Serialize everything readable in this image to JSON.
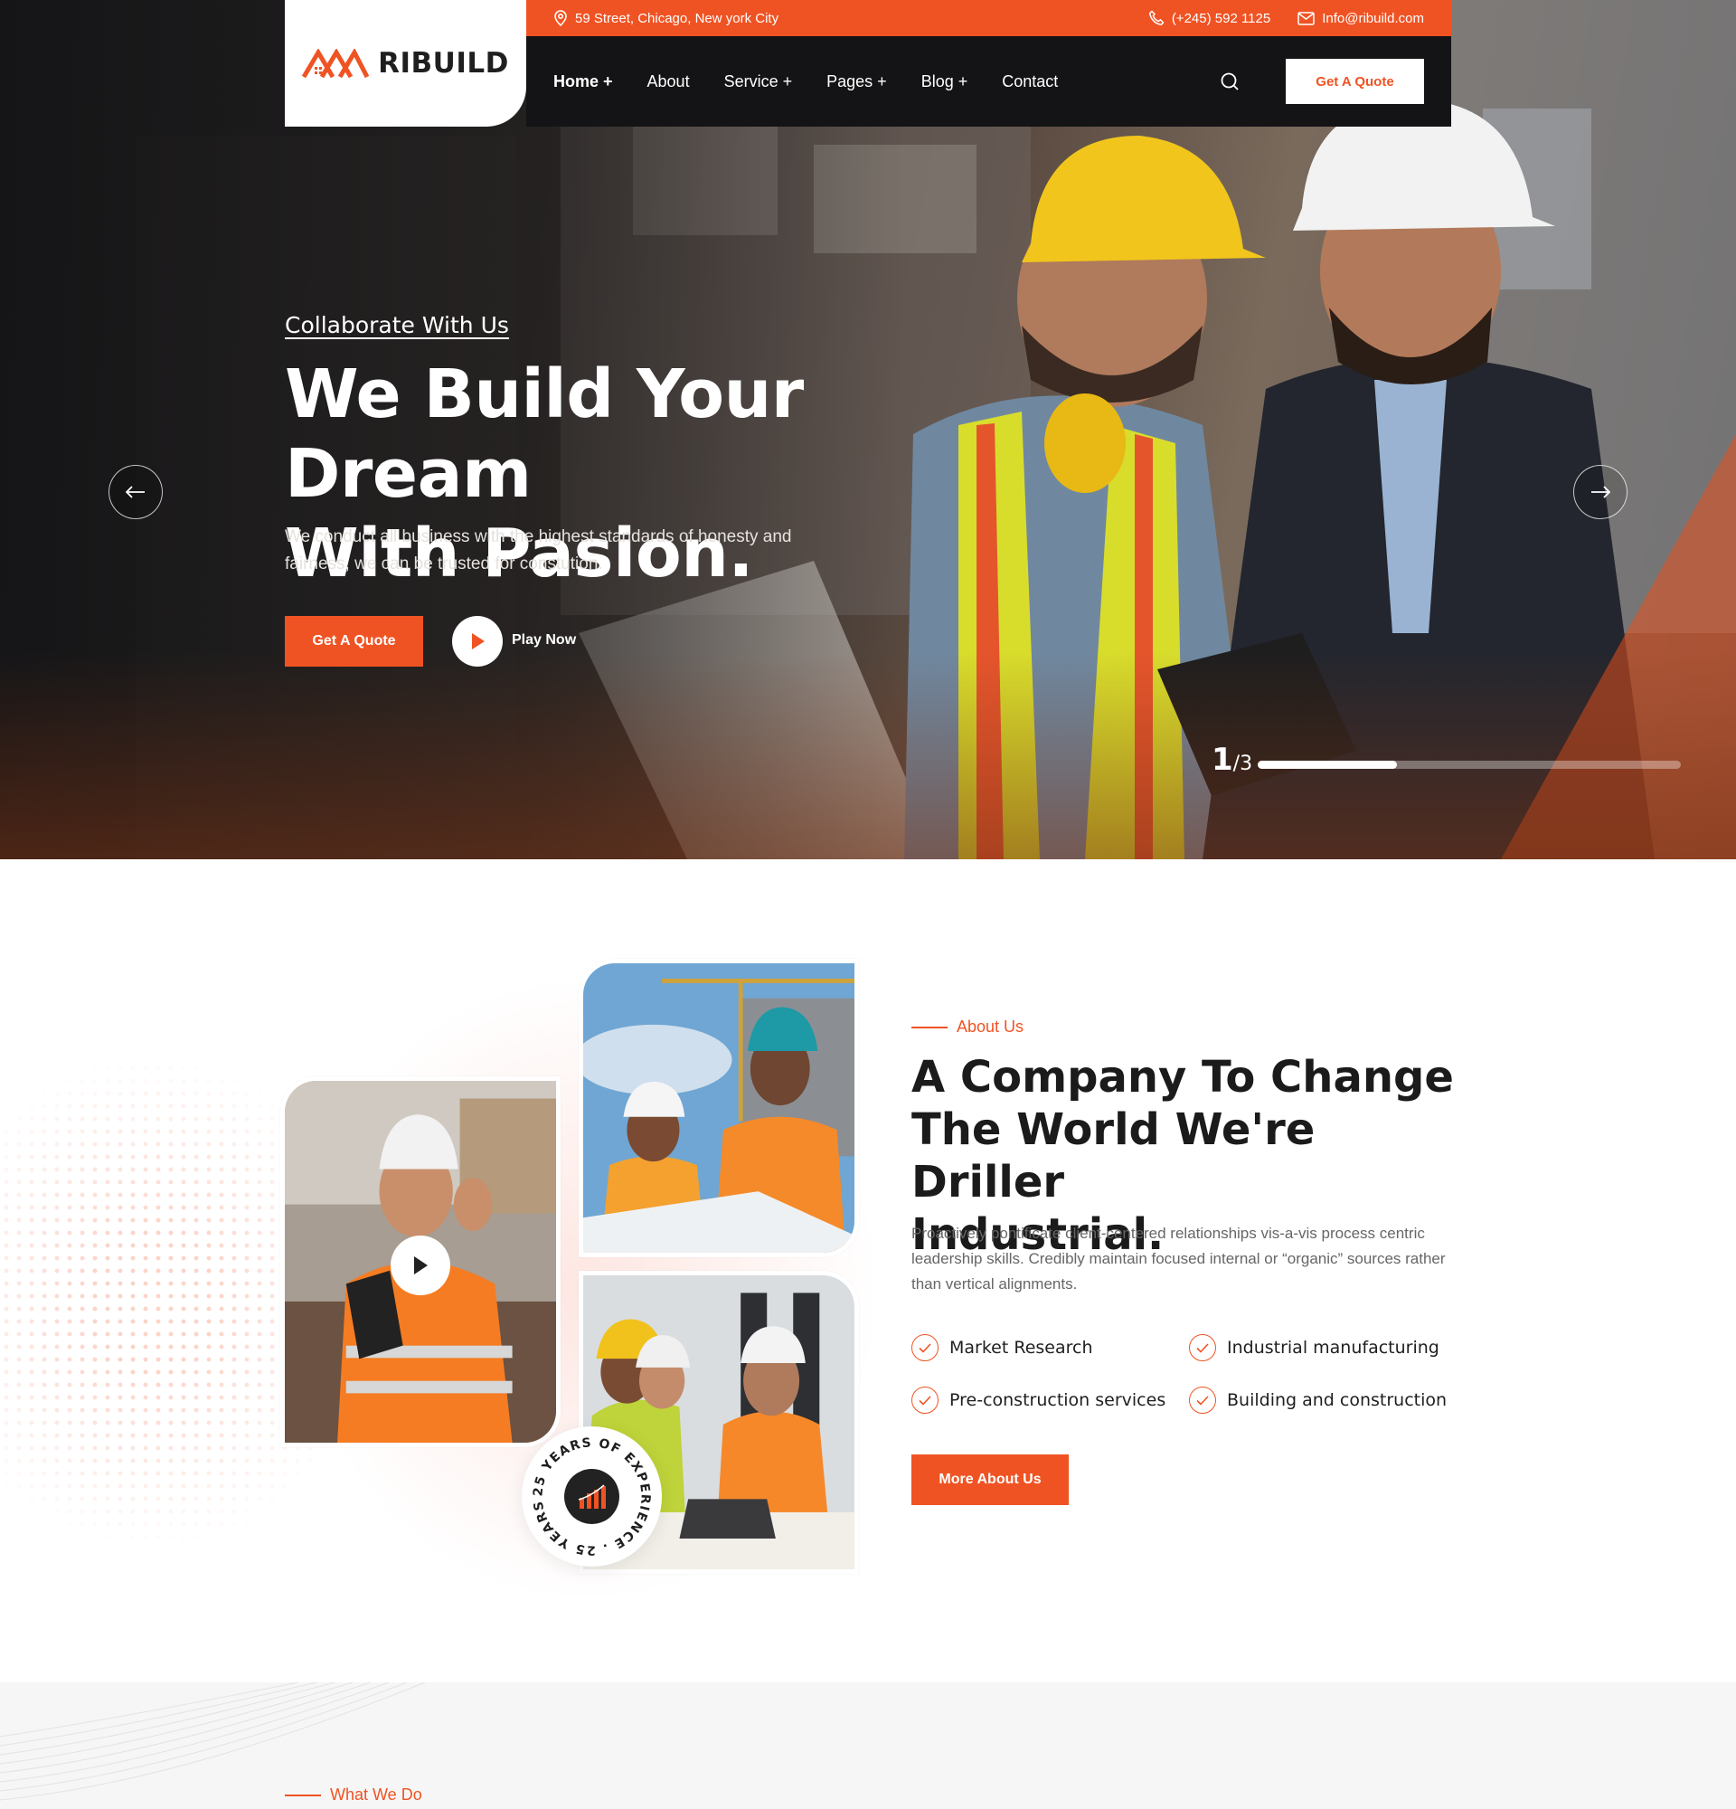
{
  "brand": {
    "name": "RIBUILD",
    "accent": "#f05323",
    "dark": "#141416"
  },
  "topbar": {
    "address": "59 Street, Chicago, New york City",
    "phone": "(+245) 592 1125",
    "email": "Info@ribuild.com"
  },
  "nav": {
    "items": [
      {
        "label": "Home +",
        "active": true
      },
      {
        "label": "About"
      },
      {
        "label": "Service +"
      },
      {
        "label": "Pages +"
      },
      {
        "label": "Blog +"
      },
      {
        "label": "Contact"
      }
    ],
    "quote_label": "Get A Quote",
    "icons": {
      "search": "search-icon"
    }
  },
  "hero": {
    "tag": "Collaborate With Us",
    "title_line1": "We Build Your Dream",
    "title_line2": "With Pasion.",
    "description": "We conduct all business with the highest standards of honesty and fairness, we can be trusted for constution.",
    "quote_label": "Get A Quote",
    "play_label": "Play Now",
    "slide_current": "1",
    "slide_total": "/3",
    "progress": 0.33
  },
  "about": {
    "tag": "About Us",
    "title_line1": "A Company To Change",
    "title_line2": "The World We're Driller",
    "title_line3": "Industrial.",
    "description": "Proactively pontificate client-centered relationships vis-a-vis process centric leadership skills. Credibly maintain focused internal or “organic” sources rather than vertical alignments.",
    "features": [
      "Market Research",
      "Industrial manufacturing",
      "Pre-construction services",
      "Building and construction"
    ],
    "button_label": "More About Us",
    "badge_text": "25 YEARS OF EXPERIENCE . 25 YEARS OF EXPERIENCE . "
  },
  "services": {
    "tag": "What We Do"
  }
}
